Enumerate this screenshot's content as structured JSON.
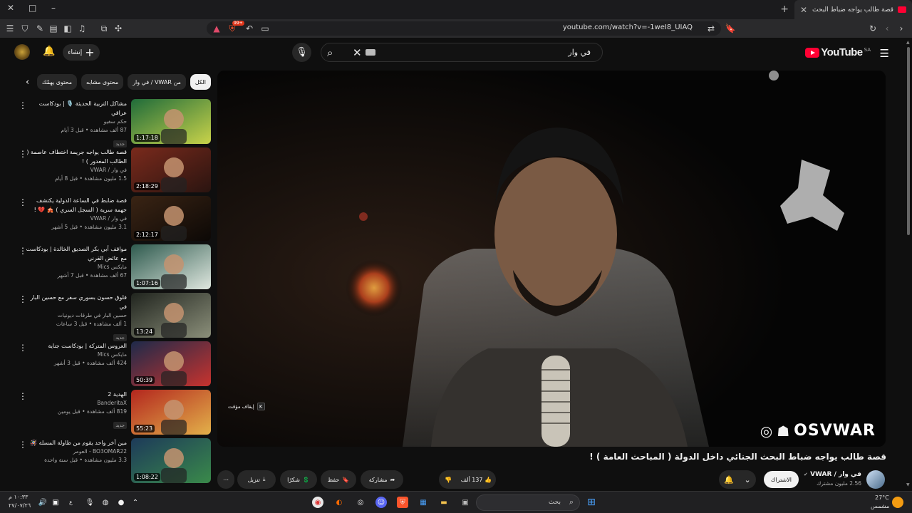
{
  "browser": {
    "tab_title": "قصة طالب يواجه ضباط البحث ال",
    "url": "youtube.com/watch?v=-1weI8_UIAQ",
    "window": {
      "close": "✕",
      "maximize": "□",
      "minimize": "–"
    },
    "new_tab": "+",
    "ext_badge": "99+"
  },
  "youtube": {
    "logo_text": "YouTube",
    "country": "SA",
    "search_value": "في وار",
    "create_label": "إنشاء",
    "chips": [
      {
        "label": "الكل",
        "active": true
      },
      {
        "label": "من VWAR / في وار",
        "active": false
      },
      {
        "label": "محتوى مشابه",
        "active": false
      },
      {
        "label": "محتوى يهمّك",
        "active": false
      }
    ],
    "related": [
      {
        "title": "مشاكل التربية الحديثة 🎙️ | بودكاست عراقي",
        "channel": "حكم سفيو",
        "stats": "87 ألف مشاهدة • قبل 3 أيام",
        "badge": "جديد",
        "duration": "1:17:18",
        "c1": "#1f6b3a",
        "c2": "#c9d34a"
      },
      {
        "title": "قصة طالب يواجه جريمة اختطاف عاصمة ( الطالب المغدور ) !",
        "channel": "في وار / VWAR",
        "stats": "1.5 مليون مشاهدة • قبل 8 أيام",
        "badge": "",
        "duration": "2:18:29",
        "c1": "#7a2a1c",
        "c2": "#2a1410"
      },
      {
        "title": "قصة ضابط في الساعة الدولية يكتشف جهمة سرية ( السجل السري ) 🎪 💔 !",
        "channel": "في وار / VWAR",
        "stats": "3.1 مليون مشاهدة • قبل 5 أشهر",
        "badge": "",
        "duration": "2:12:17",
        "c1": "#3a2414",
        "c2": "#0c0806"
      },
      {
        "title": "مواقف أبي بكر الصديق الخالدة | بودكاست مع عائض القرني",
        "channel": "مايكس Mics",
        "stats": "67 ألف مشاهدة • قبل 7 أشهر",
        "badge": "",
        "duration": "1:07:16",
        "c1": "#2e5a4e",
        "c2": "#dfe7df"
      },
      {
        "title": "فلوق حسون بسوري سفر مع حسين البار في",
        "channel": "حسين البار في طرقات ديونيات",
        "stats": "1 ألف مشاهدة • قبل 3 ساعات",
        "badge": "جديد",
        "duration": "13:24",
        "c1": "#20241e",
        "c2": "#8b8f7a"
      },
      {
        "title": "العروس المتركة | بودكاست جناية",
        "channel": "مايكس Mics",
        "stats": "424 ألف مشاهدة • قبل 3 أشهر",
        "badge": "",
        "duration": "50:39",
        "c1": "#1d2a4a",
        "c2": "#c8332e"
      },
      {
        "title": "الهدية 2",
        "channel": "BanderitaX",
        "stats": "819 ألف مشاهدة • قبل يومين",
        "badge": "جديد",
        "duration": "55:23",
        "c1": "#b3261e",
        "c2": "#e3b14a"
      },
      {
        "title": "مين آخر واحد يقوم من طاولة المسلة 🪅",
        "channel": "BO3OMAR22 - العومر",
        "stats": "3.3 مليون مشاهدة • قبل سنة واحدة",
        "badge": "",
        "duration": "1:08:22",
        "c1": "#1d3a5a",
        "c2": "#3a8a4a"
      }
    ],
    "player": {
      "pause_hint": "إيقاف مؤقت",
      "pause_key": "K",
      "watermark": "OSVWAR"
    },
    "video": {
      "title": "قصة طالب يواجه ضباط البحث الجنائي داخل الدولة ( المباحث العامة ) !",
      "channel_name": "في وار / VWAR",
      "subscribers": "2.56 مليون مشترك",
      "subscribe_label": "الاشتراك",
      "likes": "137 ألف",
      "share_label": "مشاركة",
      "save_label": "حفظ",
      "thanks_label": "شكرًا",
      "download_label": "تنزيل"
    }
  },
  "taskbar": {
    "search_label": "بحث",
    "weather_temp": "27°C",
    "weather_desc": "مشمس",
    "time": "١٠:٣٣ م",
    "date": "٢٧/٠٧/٢٦",
    "lang": "ع"
  }
}
